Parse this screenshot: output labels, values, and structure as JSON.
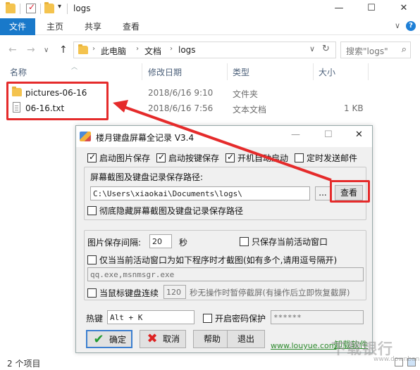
{
  "window": {
    "title": "logs",
    "minimize": "—",
    "maximize": "☐",
    "close": "✕"
  },
  "ribbon": {
    "tabs": [
      "文件",
      "主页",
      "共享",
      "查看"
    ],
    "expand": "∨",
    "help": "?"
  },
  "nav": {
    "back": "←",
    "forward": "→",
    "recent": "∨",
    "up": "↑",
    "breadcrumb": [
      "此电脑",
      "文档",
      "logs"
    ],
    "sep": "›",
    "dropdown": "∨",
    "refresh": "↻",
    "search_placeholder": "搜索\"logs\"",
    "search_icon": "search-icon"
  },
  "columns": {
    "name": "名称",
    "modified": "修改日期",
    "type": "类型",
    "size": "大小"
  },
  "files": [
    {
      "name": "pictures-06-16",
      "modified": "2018/6/16 9:10",
      "type": "文件夹",
      "size": "",
      "icon": "folder-icon"
    },
    {
      "name": "06-16.txt",
      "modified": "2018/6/16 7:56",
      "type": "文本文档",
      "size": "1 KB",
      "icon": "text-file-icon"
    }
  ],
  "status": {
    "count": "2 个项目"
  },
  "dialog": {
    "title": "楼月键盘屏幕全记录 V3.4",
    "minimize": "—",
    "maximize": "☐",
    "close": "✕",
    "opt_image_save": "启动图片保存",
    "opt_key_save": "启动按键保存",
    "opt_autostart": "开机自动启动",
    "opt_email": "定时发送邮件",
    "path_label": "屏幕截图及键盘记录保存路径:",
    "path_value": "C:\\Users\\xiaokai\\Documents\\logs\\",
    "browse_dots": "...",
    "view_button": "查看",
    "hide_path": "彻底隐藏屏幕截图及键盘记录保存路径",
    "interval_label": "图片保存间隔:",
    "interval_value": "20",
    "interval_unit": "秒",
    "active_only": "只保存当前活动窗口",
    "program_only": "仅当当前活动窗口为如下程序时才截图(如有多个,请用逗号隔开)",
    "program_list": "qq.exe,msnmsgr.exe",
    "idle_prefix": "当鼠标键盘连续",
    "idle_value": "120",
    "idle_suffix": "秒无操作时暂停截屏(有操作后立即恢复截屏)",
    "hotkey_label": "热键",
    "hotkey_value": "Alt + K",
    "pwd_label": "开启密码保护",
    "pwd_value": "******",
    "ok": "确定",
    "cancel": "取消",
    "help": "帮助",
    "exit": "退出",
    "site": "www.louyue.com",
    "uninstall": "卸载软件"
  },
  "watermark": {
    "brand": "下载银行",
    "url": "www.downbank.cn"
  },
  "colors": {
    "accent": "#1979ca",
    "highlight": "#e52b2b"
  }
}
